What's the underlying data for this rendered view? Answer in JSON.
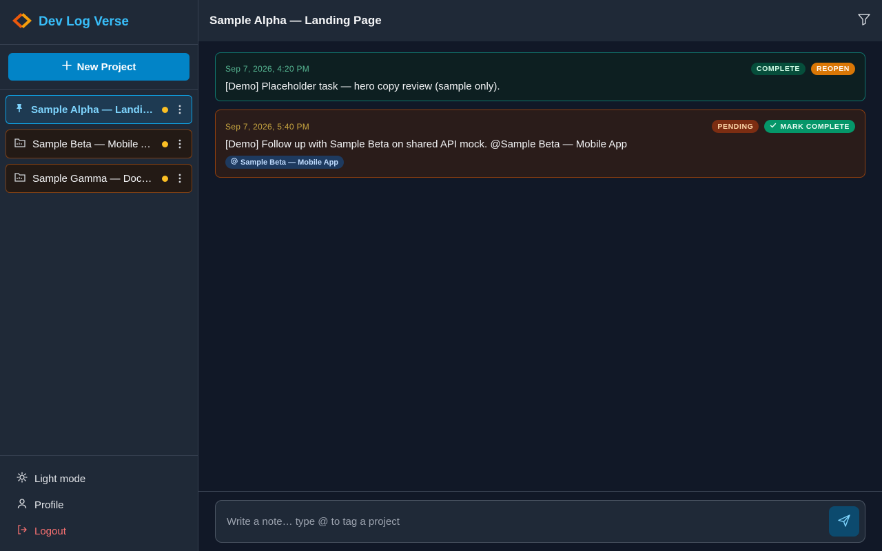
{
  "app": {
    "title": "Dev Log Verse"
  },
  "sidebar": {
    "new_project_label": "New Project",
    "projects": [
      {
        "label": "Sample Alpha — Landing Page",
        "active": true,
        "status_color": "#fbbf24"
      },
      {
        "label": "Sample Beta — Mobile App",
        "active": false,
        "status_color": "#fbbf24"
      },
      {
        "label": "Sample Gamma — Docs Site",
        "active": false,
        "status_color": "#fbbf24"
      }
    ],
    "footer": {
      "light_mode": "Light mode",
      "profile": "Profile",
      "logout": "Logout"
    }
  },
  "main": {
    "title": "Sample Alpha — Landing Page",
    "notes": [
      {
        "timestamp": "Sep 7, 2026, 4:20 PM",
        "status_badge": "COMPLETE",
        "action_label": "REOPEN",
        "text": "[Demo] Placeholder task — hero copy review (sample only)."
      },
      {
        "timestamp": "Sep 7, 2026, 5:40 PM",
        "status_badge": "PENDING",
        "action_label": "MARK COMPLETE",
        "text": "[Demo] Follow up with Sample Beta on shared API mock. @Sample Beta — Mobile App",
        "tag": "Sample Beta — Mobile App"
      }
    ],
    "composer": {
      "placeholder": "Write a note… type @ to tag a project"
    }
  },
  "colors": {
    "accent": "#0284c7",
    "brand_text": "#38bdf8",
    "complete": "#064e3b",
    "reopen": "#d97706",
    "pending": "#7c2d12",
    "mark_complete": "#059669",
    "logout": "#f87171"
  },
  "icons": [
    "logo-icon",
    "plus-icon",
    "pin-icon",
    "folder-icon",
    "kebab-icon",
    "sun-icon",
    "user-icon",
    "logout-icon",
    "filter-icon",
    "check-icon",
    "at-icon",
    "send-icon"
  ]
}
